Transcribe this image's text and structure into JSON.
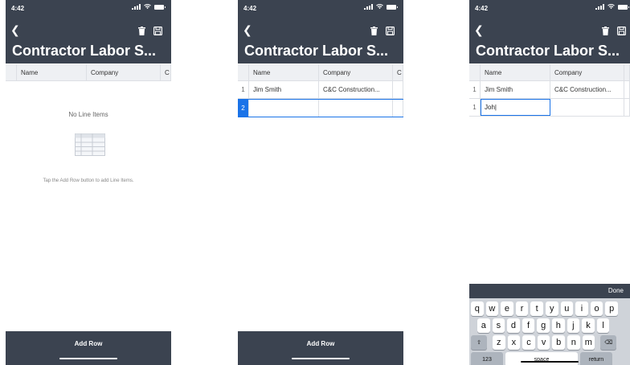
{
  "status": {
    "time": "4:42"
  },
  "header": {
    "title": "Contractor Labor S..."
  },
  "table": {
    "columns": [
      "Name",
      "Company",
      "C"
    ],
    "rows": [
      {
        "index": "1",
        "name": "Jim Smith",
        "company": "C&C Construction..."
      }
    ],
    "new_row_index_p2": "2",
    "new_row_index_p3": "1",
    "editing_value": "Joh|"
  },
  "empty_state": {
    "title": "No Line Items",
    "hint": "Tap the Add Row button to add Line Items."
  },
  "footer": {
    "add_row_label": "Add Row"
  },
  "keyboard": {
    "done_label": "Done",
    "row1": [
      "q",
      "w",
      "e",
      "r",
      "t",
      "y",
      "u",
      "i",
      "o",
      "p"
    ],
    "row2": [
      "a",
      "s",
      "d",
      "f",
      "g",
      "h",
      "j",
      "k",
      "l"
    ],
    "row3": [
      "z",
      "x",
      "c",
      "v",
      "b",
      "n",
      "m"
    ],
    "numbers_label": "123",
    "space_label": "space",
    "return_label": "return"
  },
  "colors": {
    "nav": "#3b4350",
    "accent": "#1a73e8"
  }
}
